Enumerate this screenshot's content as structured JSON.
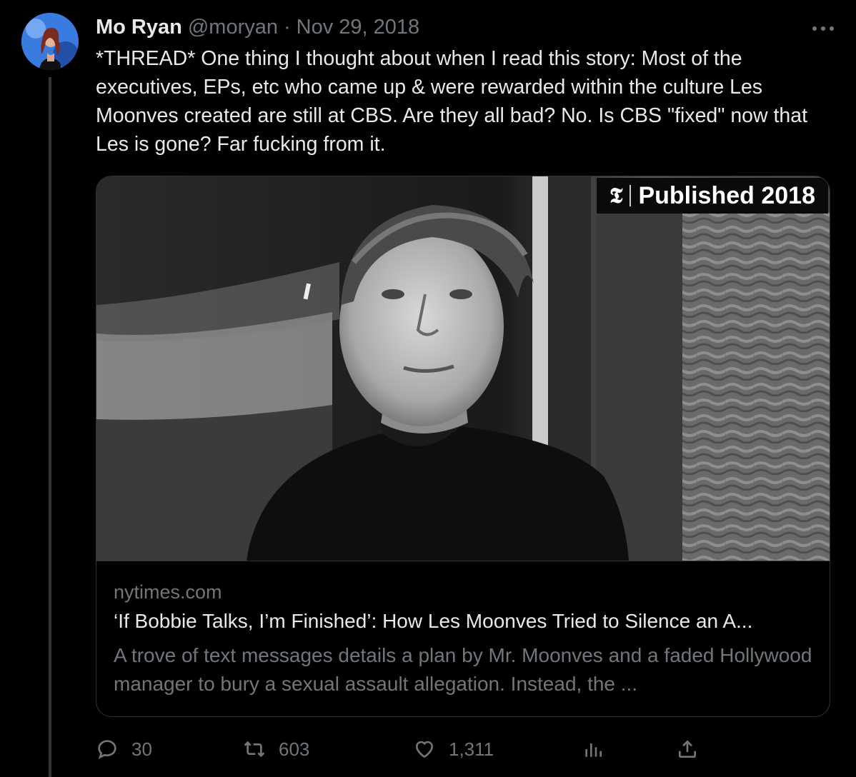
{
  "author": {
    "name": "Mo Ryan",
    "handle": "@moryan",
    "separator": "·",
    "date": "Nov 29, 2018"
  },
  "tweet_text": "*THREAD* One thing I thought about when I read this story: Most of the executives, EPs, etc who came up & were rewarded within the culture Les Moonves created are still at CBS. Are they all bad? No. Is CBS \"fixed\" now that Les is gone? Far fucking from it.",
  "card": {
    "badge_logo": "𝕿",
    "badge_text": "Published 2018",
    "domain": "nytimes.com",
    "headline": "‘If Bobbie Talks, I’m Finished’: How Les Moonves Tried to Silence an A...",
    "description": "A trove of text messages details a plan by Mr. Moonves and a faded Hollywood manager to bury a sexual assault allegation. Instead, the ..."
  },
  "actions": {
    "replies": "30",
    "retweets": "603",
    "likes": "1,311"
  },
  "icons": [
    "more-icon",
    "reply-icon",
    "retweet-icon",
    "like-icon",
    "views-icon",
    "share-icon",
    "nyt-logo-icon"
  ],
  "colors": {
    "background": "#000000",
    "text": "#e7e9ea",
    "muted": "#71767b",
    "border": "#2f3336"
  }
}
